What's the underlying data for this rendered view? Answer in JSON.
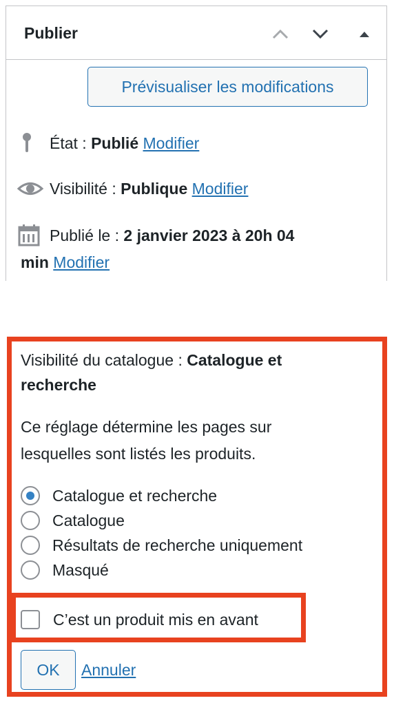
{
  "panel": {
    "title": "Publier",
    "header_icons": [
      "chevron-up-icon",
      "chevron-down-icon",
      "triangle-up-icon"
    ],
    "preview_button": "Prévisualiser les modifications",
    "status": {
      "label": "État : ",
      "value": "Publié",
      "link": "Modifier",
      "icon": "pin-icon"
    },
    "visibility": {
      "label": "Visibilité : ",
      "value": "Publique",
      "link": "Modifier",
      "icon": "eye-icon"
    },
    "published": {
      "label": "Publié le : ",
      "value_line1": "2 janvier 2023 à 20h 04",
      "value_line2": "min",
      "link": "Modifier",
      "icon": "calendar-icon"
    }
  },
  "catalog": {
    "label": "Visibilité du catalogue : ",
    "value_line1": "Catalogue et",
    "value_line2": "recherche",
    "description_line1": "Ce réglage détermine les pages sur",
    "description_line2": "lesquelles sont listés les produits.",
    "options": [
      {
        "label": "Catalogue et recherche",
        "checked": true
      },
      {
        "label": "Catalogue",
        "checked": false
      },
      {
        "label": "Résultats de recherche uniquement",
        "checked": false
      },
      {
        "label": "Masqué",
        "checked": false
      }
    ],
    "featured_label": "C’est un produit mis en avant",
    "featured_checked": false,
    "ok_label": "OK",
    "cancel_label": "Annuler"
  },
  "colors": {
    "accent": "#2271b1",
    "highlight": "#e8421f",
    "radio_checked": "#3582c4"
  }
}
